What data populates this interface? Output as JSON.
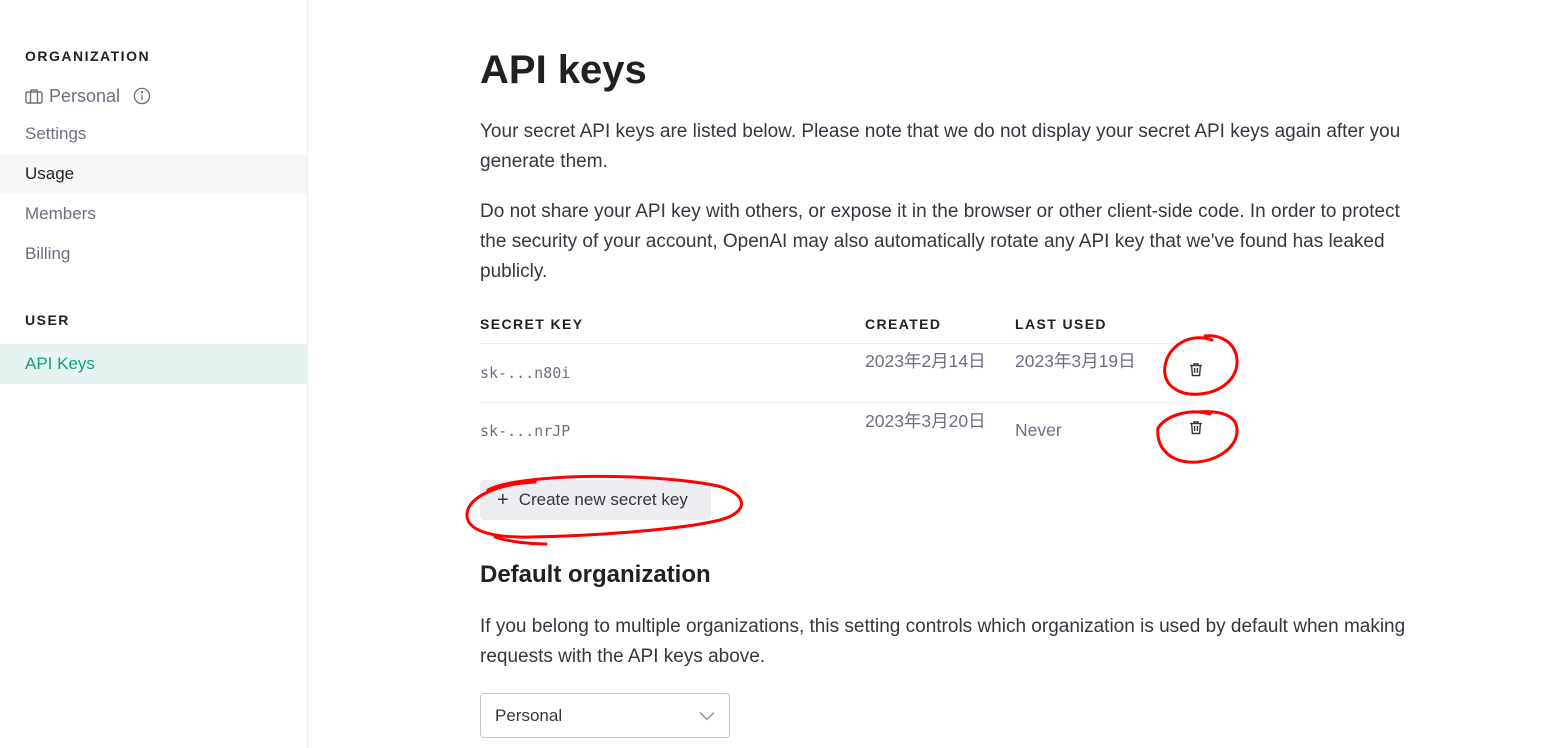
{
  "sidebar": {
    "organization_heading": "ORGANIZATION",
    "org_name": "Personal",
    "org_icon": "briefcase-icon",
    "info_icon": "info-icon",
    "items": [
      {
        "label": "Settings"
      },
      {
        "label": "Usage"
      },
      {
        "label": "Members"
      },
      {
        "label": "Billing"
      }
    ],
    "user_heading": "USER",
    "user_items": [
      {
        "label": "API Keys"
      }
    ]
  },
  "main": {
    "title": "API keys",
    "intro": "Your secret API keys are listed below. Please note that we do not display your secret API keys again after you generate them.",
    "warning": "Do not share your API key with others, or expose it in the browser or other client-side code. In order to protect the security of your account, OpenAI may also automatically rotate any API key that we've found has leaked publicly.",
    "table": {
      "headers": [
        "SECRET KEY",
        "CREATED",
        "LAST USED"
      ],
      "rows": [
        {
          "key": "sk-...n80i",
          "created": "2023年2月14日",
          "last_used": "2023年3月19日"
        },
        {
          "key": "sk-...nrJP",
          "created": "2023年3月20日",
          "last_used": "Never"
        }
      ],
      "delete_icon": "trash-icon"
    },
    "create_button": "Create new secret key",
    "default_org": {
      "title": "Default organization",
      "description": "If you belong to multiple organizations, this setting controls which organization is used by default when making requests with the API keys above.",
      "selected": "Personal"
    }
  },
  "colors": {
    "accent": "#10a37f",
    "annotation": "#ff0000"
  }
}
